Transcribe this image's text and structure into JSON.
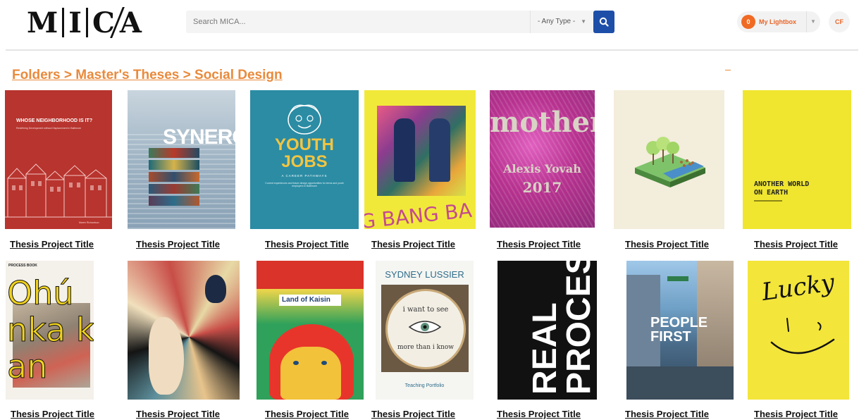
{
  "header": {
    "logo": {
      "letters": [
        "M",
        "I",
        "C",
        "A"
      ]
    },
    "search": {
      "placeholder": "Search MICA...",
      "type_selected": "- Any Type -"
    },
    "lightbox": {
      "count": "0",
      "label": "My Lightbox"
    },
    "user_initials": "CF"
  },
  "breadcrumb": "Folders > Master's Theses > Social Design",
  "items": [
    {
      "caption": "Thesis Project Title",
      "cover": {
        "title": "WHOSE NEIGHBORHOOD IS IT?",
        "subtitle": "Redefining Development without Displacement in Baltimore",
        "author": "Maren Richardson"
      }
    },
    {
      "caption": "Thesis Project Title",
      "cover": {
        "title": "SYNERGY"
      }
    },
    {
      "caption": "Thesis Project Title",
      "cover": {
        "title_line1": "YOUTH",
        "title_line2": "JOBS",
        "subtitle": "A CAREER PATHWAYS",
        "blurb": "Current experiences and future design opportunities for teens and youth employers in Baltimore"
      }
    },
    {
      "caption": "Thesis Project Title",
      "cover": {
        "text": "G BANG BA"
      }
    },
    {
      "caption": "Thesis Project Title",
      "cover": {
        "title": "mother",
        "author": "Alexis Yovah",
        "year": "2017"
      }
    },
    {
      "caption": "Thesis Project Title",
      "cover": {}
    },
    {
      "caption": "Thesis Project Title",
      "cover": {
        "title_line1": "ANOTHER WORLD",
        "title_line2": "ON EARTH"
      }
    },
    {
      "caption": "Thesis Project Title",
      "cover": {
        "heading": "PROCESS BOOK",
        "text": "Ohú nka kan"
      }
    },
    {
      "caption": "Thesis Project Title",
      "cover": {}
    },
    {
      "caption": "Thesis Project Title",
      "cover": {
        "title": "Land of Kaisin"
      }
    },
    {
      "caption": "Thesis Project Title",
      "cover": {
        "author": "SYDNEY LUSSIER",
        "hoop_line1": "i want to see",
        "hoop_line2": "more than i know",
        "subtitle": "Teaching Portfolio"
      }
    },
    {
      "caption": "Thesis Project Title",
      "cover": {
        "line1": "REAL",
        "line2": "PROCESS."
      }
    },
    {
      "caption": "Thesis Project Title",
      "cover": {
        "line1": "PEOPLE",
        "line2": "FIRST"
      }
    },
    {
      "caption": "Thesis Project Title",
      "cover": {
        "title": "Lucky"
      }
    }
  ],
  "colors": {
    "accent": "#e98a3c",
    "search_button": "#1e4fa8",
    "lightbox_badge": "#f06a24"
  }
}
